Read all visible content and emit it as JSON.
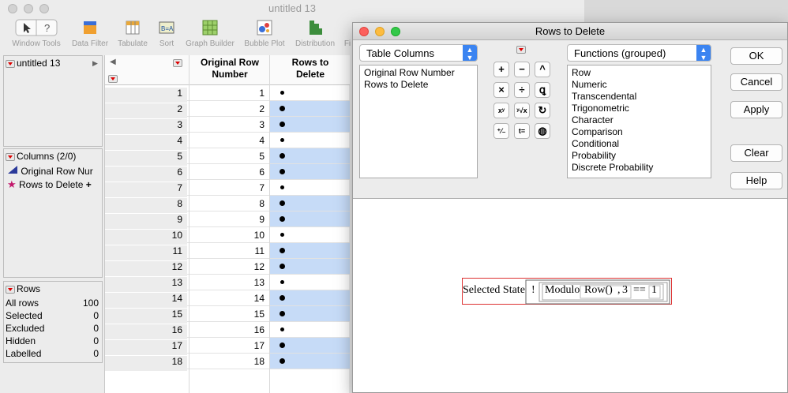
{
  "main_window": {
    "title": "untitled 13",
    "toolbar": [
      {
        "label": "Window Tools",
        "icon": "window-tools-icon"
      },
      {
        "label": "Data Filter",
        "icon": "data-filter-icon"
      },
      {
        "label": "Tabulate",
        "icon": "tabulate-icon"
      },
      {
        "label": "Sort",
        "icon": "sort-icon"
      },
      {
        "label": "Graph Builder",
        "icon": "graph-builder-icon"
      },
      {
        "label": "Bubble Plot",
        "icon": "bubble-plot-icon"
      },
      {
        "label": "Distribution",
        "icon": "distribution-icon"
      },
      {
        "label": "Fi",
        "icon": "fit-icon"
      }
    ]
  },
  "table_panel": {
    "title": "untitled 13"
  },
  "columns_panel": {
    "title": "Columns (2/0)",
    "items": [
      "Original Row Nur",
      "Rows to Delete"
    ]
  },
  "rows_panel": {
    "title": "Rows",
    "items": [
      {
        "label": "All rows",
        "value": "100"
      },
      {
        "label": "Selected",
        "value": "0"
      },
      {
        "label": "Excluded",
        "value": "0"
      },
      {
        "label": "Hidden",
        "value": "0"
      },
      {
        "label": "Labelled",
        "value": "0"
      }
    ]
  },
  "grid": {
    "col1_line1": "Original Row",
    "col1_line2": "Number",
    "col2_line1": "Rows to",
    "col2_line2": "Delete",
    "rows": [
      {
        "n": "1",
        "orig": "1",
        "sel": false
      },
      {
        "n": "2",
        "orig": "2",
        "sel": true
      },
      {
        "n": "3",
        "orig": "3",
        "sel": true
      },
      {
        "n": "4",
        "orig": "4",
        "sel": false
      },
      {
        "n": "5",
        "orig": "5",
        "sel": true
      },
      {
        "n": "6",
        "orig": "6",
        "sel": true
      },
      {
        "n": "7",
        "orig": "7",
        "sel": false
      },
      {
        "n": "8",
        "orig": "8",
        "sel": true
      },
      {
        "n": "9",
        "orig": "9",
        "sel": true
      },
      {
        "n": "10",
        "orig": "10",
        "sel": false
      },
      {
        "n": "11",
        "orig": "11",
        "sel": true
      },
      {
        "n": "12",
        "orig": "12",
        "sel": true
      },
      {
        "n": "13",
        "orig": "13",
        "sel": false
      },
      {
        "n": "14",
        "orig": "14",
        "sel": true
      },
      {
        "n": "15",
        "orig": "15",
        "sel": true
      },
      {
        "n": "16",
        "orig": "16",
        "sel": false
      },
      {
        "n": "17",
        "orig": "17",
        "sel": true
      },
      {
        "n": "18",
        "orig": "18",
        "sel": true
      }
    ]
  },
  "dialog": {
    "title": "Rows to Delete",
    "columns_popup": "Table Columns",
    "columns_list": [
      "Original Row Number",
      "Rows to Delete"
    ],
    "functions_popup": "Functions (grouped)",
    "functions_list": [
      "Row",
      "Numeric",
      "Transcendental",
      "Trigonometric",
      "Character",
      "Comparison",
      "Conditional",
      "Probability",
      "Discrete Probability"
    ],
    "operators": [
      {
        "symbol": "+",
        "name": "plus-icon"
      },
      {
        "symbol": "−",
        "name": "minus-icon"
      },
      {
        "symbol": "^",
        "name": "caret-icon"
      },
      {
        "symbol": "×",
        "name": "multiply-icon"
      },
      {
        "symbol": "÷",
        "name": "divide-icon"
      },
      {
        "symbol": "ꝗ",
        "name": "root-icon"
      },
      {
        "symbol": "xʸ",
        "name": "power-icon"
      },
      {
        "symbol": "ʸ√x",
        "name": "nth-root-icon"
      },
      {
        "symbol": "↻",
        "name": "swap-icon"
      },
      {
        "symbol": "⁺⁄₋",
        "name": "negate-icon"
      },
      {
        "symbol": "t=",
        "name": "assign-icon"
      },
      {
        "symbol": "◍",
        "name": "peel-icon"
      }
    ],
    "buttons": {
      "ok": "OK",
      "cancel": "Cancel",
      "apply": "Apply",
      "clear": "Clear",
      "help": "Help"
    },
    "formula": {
      "prefix": "Selected State",
      "not": "!",
      "func": "Modulo",
      "arg1": "Row()",
      "sep": ",",
      "arg2": "3",
      "op": "==",
      "rhs": "1"
    }
  }
}
